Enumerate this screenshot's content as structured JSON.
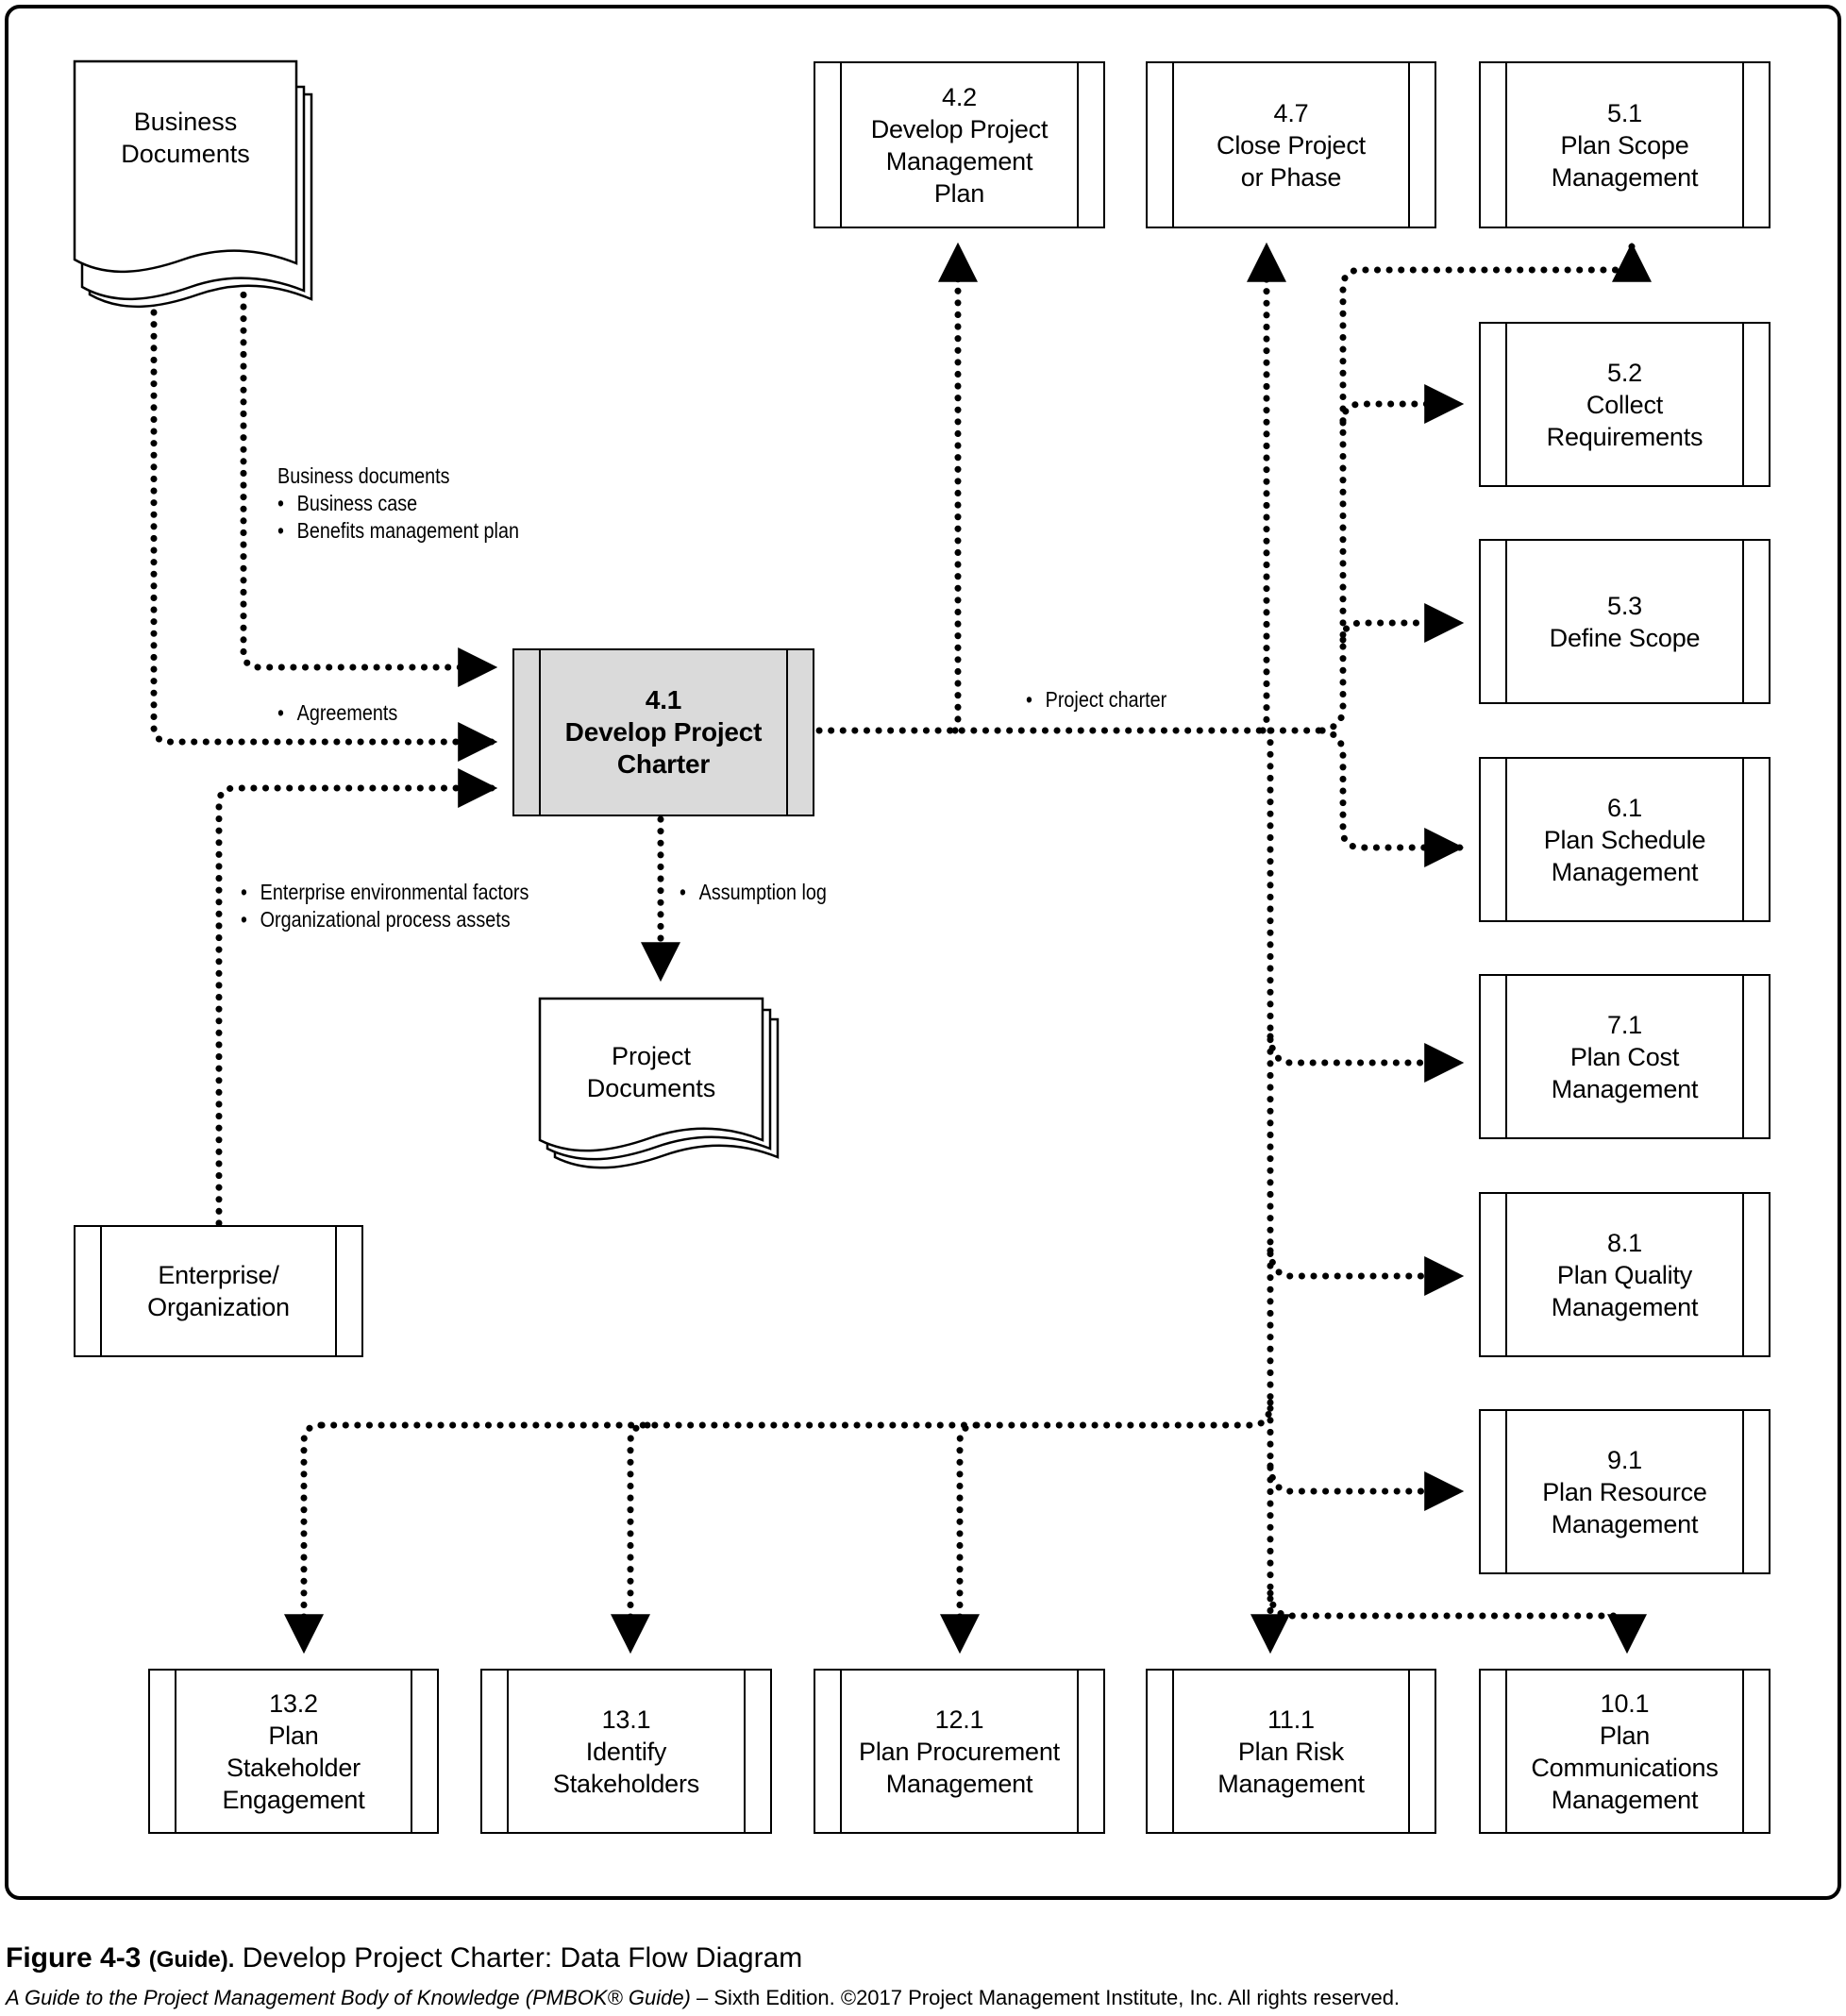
{
  "figure": {
    "caption_number": "Figure 4-3",
    "caption_tag": "(Guide).",
    "caption_title": "Develop Project Charter: Data Flow Diagram",
    "credit_italic": "A Guide to the Project Management Body of Knowledge (PMBOK® Guide)",
    "credit_rest": " – Sixth Edition. ©2017 Project Management Institute, Inc. All rights reserved."
  },
  "documents": {
    "business": [
      "Business",
      "Documents"
    ],
    "project": [
      "Project",
      "Documents"
    ]
  },
  "processes": {
    "center": [
      "4.1",
      "Develop Project",
      "Charter"
    ],
    "enterprise": [
      "Enterprise/",
      "Organization"
    ],
    "p42": [
      "4.2",
      "Develop Project",
      "Management",
      "Plan"
    ],
    "p47": [
      "4.7",
      "Close Project",
      "or Phase"
    ],
    "p51": [
      "5.1",
      "Plan Scope",
      "Management"
    ],
    "p52": [
      "5.2",
      "Collect",
      "Requirements"
    ],
    "p53": [
      "5.3",
      "Define Scope"
    ],
    "p61": [
      "6.1",
      "Plan Schedule",
      "Management"
    ],
    "p71": [
      "7.1",
      "Plan Cost",
      "Management"
    ],
    "p81": [
      "8.1",
      "Plan Quality",
      "Management"
    ],
    "p91": [
      "9.1",
      "Plan Resource",
      "Management"
    ],
    "p132": [
      "13.2",
      "Plan",
      "Stakeholder",
      "Engagement"
    ],
    "p131": [
      "13.1",
      "Identify",
      "Stakeholders"
    ],
    "p121": [
      "12.1",
      "Plan Procurement",
      "Management"
    ],
    "p111": [
      "11.1",
      "Plan Risk",
      "Management"
    ],
    "p101": [
      "10.1",
      "Plan",
      "Communications",
      "Management"
    ]
  },
  "flows": {
    "business_docs": {
      "heading": "Business documents",
      "items": [
        "Business case",
        "Benefits management plan"
      ]
    },
    "agreements": {
      "items": [
        "Agreements"
      ]
    },
    "enterprise": {
      "items": [
        "Enterprise environmental factors",
        "Organizational process assets"
      ]
    },
    "assumption": {
      "items": [
        "Assumption log"
      ]
    },
    "charter": {
      "items": [
        "Project charter"
      ]
    }
  }
}
